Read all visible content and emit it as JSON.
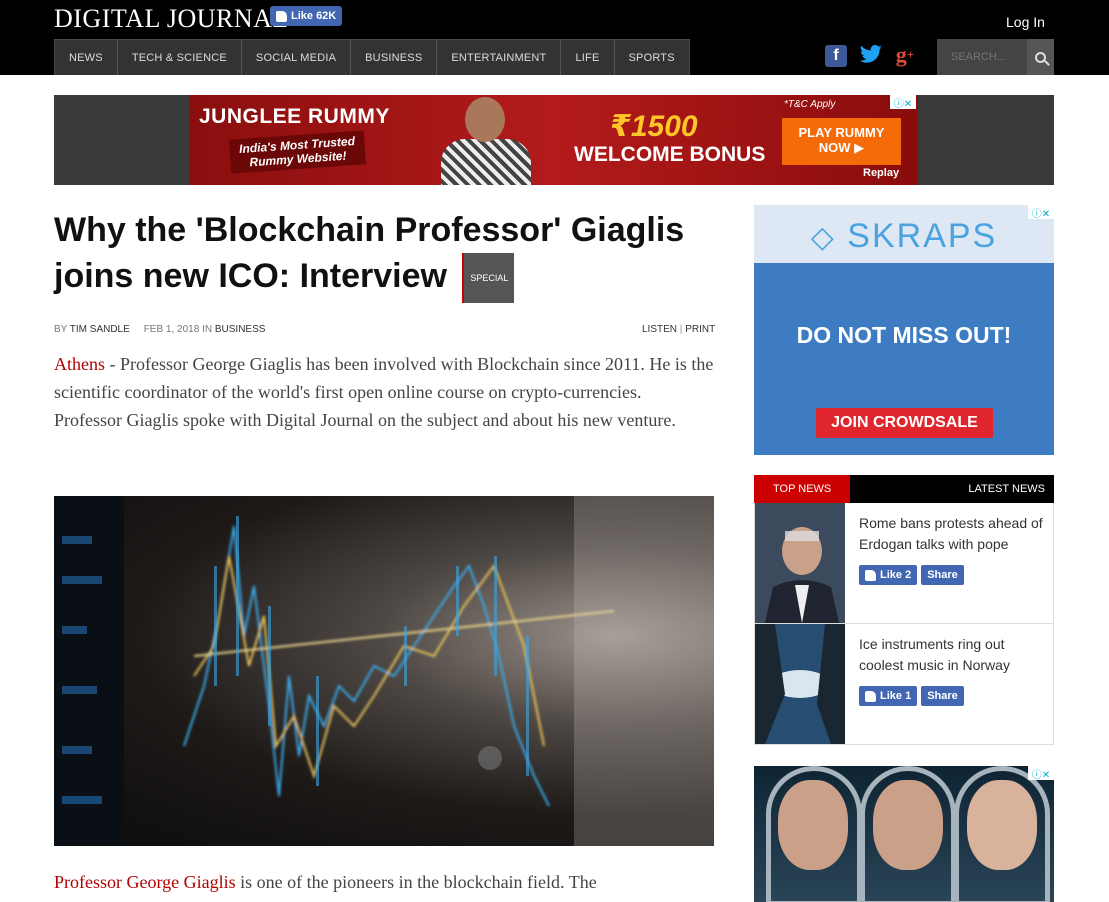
{
  "header": {
    "logo": "DIGITAL JOURNAL",
    "fb_like": "Like 62K",
    "login": "Log In",
    "nav": [
      "NEWS",
      "TECH & SCIENCE",
      "SOCIAL MEDIA",
      "BUSINESS",
      "ENTERTAINMENT",
      "LIFE",
      "SPORTS"
    ],
    "social": [
      "facebook-icon",
      "twitter-icon",
      "google-plus-icon"
    ],
    "search_placeholder": "SEARCH..."
  },
  "top_ad": {
    "brand": "JUNGLEE RUMMY",
    "tagline": "India's Most Trusted Rummy Website!",
    "amount": "₹1500",
    "bonus": "WELCOME BONUS",
    "terms": "*T&C Apply",
    "cta": "PLAY RUMMY NOW ▶",
    "replay": "Replay"
  },
  "article": {
    "title": "Why the 'Blockchain Professor' Giaglis joins new ICO: Interview",
    "badge": "SPECIAL",
    "by_label": "BY",
    "author": "TIM SANDLE",
    "date": "FEB 1, 2018",
    "in_label": "IN",
    "category": "BUSINESS",
    "listen": "LISTEN",
    "separator": "|",
    "print": "PRINT",
    "location": "Athens",
    "lede": " - Professor George Giaglis has been involved with Blockchain since 2011. He is the scientific coordinator of the world's first open online course on crypto-currencies. Professor Giaglis spoke with Digital Journal on the subject and about his new venture.",
    "para2_link": "Professor George Giaglis",
    "para2_text": " is one of the pioneers in the blockchain field. The"
  },
  "side_ad": {
    "brand": "SKRAPS",
    "message": "DO NOT MISS OUT!",
    "cta": "JOIN CROWDSALE"
  },
  "news_tabs": {
    "top": "TOP NEWS",
    "latest": "LATEST NEWS"
  },
  "news": [
    {
      "title": "Rome bans protests ahead of Erdogan talks with pope",
      "like": "Like 2",
      "share": "Share"
    },
    {
      "title": "Ice instruments ring out coolest music in Norway",
      "like": "Like 1",
      "share": "Share"
    }
  ],
  "colors": {
    "accent_red": "#b30000",
    "facebook_blue": "#4267b2",
    "header_bg": "#000000"
  }
}
